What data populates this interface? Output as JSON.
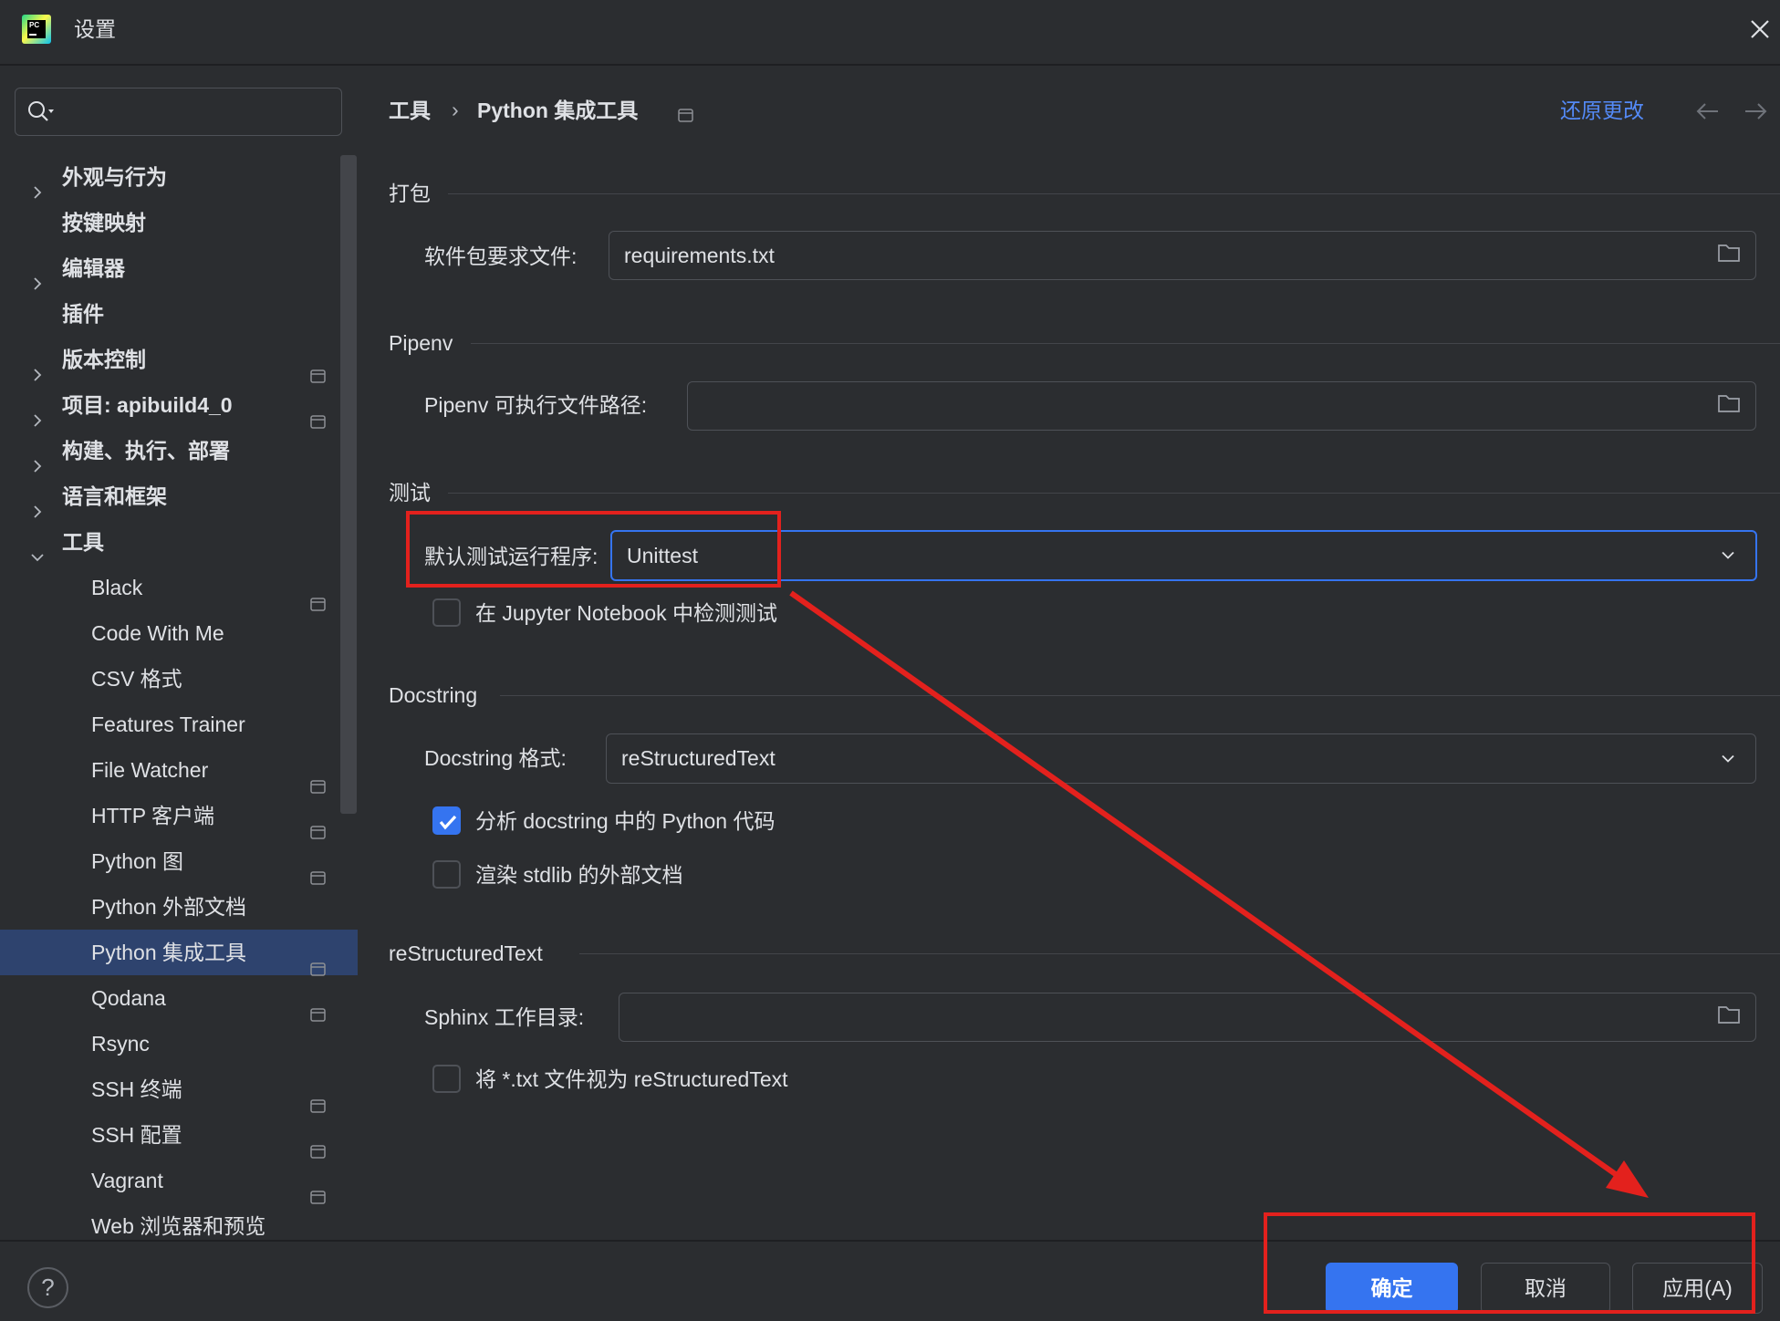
{
  "window": {
    "title": "设置",
    "app_logo_text": "PC"
  },
  "search": {
    "value": ""
  },
  "sidebar": {
    "items": [
      {
        "label": "外观与行为",
        "expandable": true
      },
      {
        "label": "按键映射"
      },
      {
        "label": "编辑器",
        "expandable": true
      },
      {
        "label": "插件"
      },
      {
        "label": "版本控制",
        "expandable": true,
        "project_scope": true
      },
      {
        "label": "项目: apibuild4_0",
        "expandable": true,
        "project_scope": true
      },
      {
        "label": "构建、执行、部署",
        "expandable": true
      },
      {
        "label": "语言和框架",
        "expandable": true
      },
      {
        "label": "工具",
        "expandable": true,
        "expanded": true
      },
      {
        "label": "Black",
        "project_scope": true
      },
      {
        "label": "Code With Me"
      },
      {
        "label": "CSV 格式"
      },
      {
        "label": "Features Trainer"
      },
      {
        "label": "File Watcher",
        "project_scope": true
      },
      {
        "label": "HTTP 客户端",
        "project_scope": true
      },
      {
        "label": "Python 图",
        "project_scope": true
      },
      {
        "label": "Python 外部文档"
      },
      {
        "label": "Python 集成工具",
        "project_scope": true,
        "selected": true
      },
      {
        "label": "Qodana",
        "project_scope": true
      },
      {
        "label": "Rsync"
      },
      {
        "label": "SSH 终端",
        "project_scope": true
      },
      {
        "label": "SSH 配置",
        "project_scope": true
      },
      {
        "label": "Vagrant",
        "project_scope": true
      },
      {
        "label": "Web 浏览器和预览"
      }
    ]
  },
  "breadcrumb": {
    "parent": "工具",
    "separator": "›",
    "current": "Python 集成工具"
  },
  "header": {
    "reset_label": "还原更改"
  },
  "sections": {
    "packaging": {
      "title": "打包",
      "requirements_label": "软件包要求文件:",
      "requirements_value": "requirements.txt"
    },
    "pipenv": {
      "title": "Pipenv",
      "path_label": "Pipenv 可执行文件路径:",
      "path_value": ""
    },
    "testing": {
      "title": "测试",
      "runner_label": "默认测试运行程序:",
      "runner_value": "Unittest",
      "jupyter_label": "在 Jupyter Notebook 中检测测试",
      "jupyter_checked": false
    },
    "docstring": {
      "title": "Docstring",
      "format_label": "Docstring 格式:",
      "format_value": "reStructuredText",
      "analyze_label": "分析 docstring 中的 Python 代码",
      "analyze_checked": true,
      "render_label": "渲染 stdlib 的外部文档",
      "render_checked": false
    },
    "restructuredtext": {
      "title": "reStructuredText",
      "sphinx_label": "Sphinx 工作目录:",
      "sphinx_value": "",
      "txt_label": "将 *.txt 文件视为 reStructuredText",
      "txt_checked": false
    }
  },
  "footer": {
    "help_label": "?",
    "ok_label": "确定",
    "cancel_label": "取消",
    "apply_label": "应用(A)"
  },
  "icons": {
    "app": "pycharm-icon",
    "close": "close-icon",
    "search": "search-icon",
    "expand": "chevron-right-icon",
    "collapse": "chevron-down-icon",
    "scope": "project-scope-icon",
    "folder": "folder-icon",
    "dropdown": "chevron-down-icon",
    "back": "arrow-left-icon",
    "forward": "arrow-right-icon"
  },
  "colors": {
    "background": "#2b2d30",
    "accent": "#3574f0",
    "link": "#548af7",
    "selection": "#2e436e",
    "annotation": "#e3211d"
  }
}
